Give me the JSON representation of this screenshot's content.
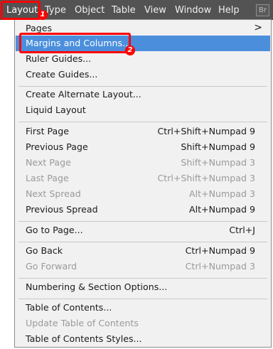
{
  "menubar": {
    "items": [
      {
        "label": "Layout"
      },
      {
        "label": "Type"
      },
      {
        "label": "Object"
      },
      {
        "label": "Table"
      },
      {
        "label": "View"
      },
      {
        "label": "Window"
      },
      {
        "label": "Help"
      }
    ],
    "badge": "Br"
  },
  "annotations": {
    "step1": "1",
    "step2": "2",
    "color": "#ff0000"
  },
  "menu": {
    "items": [
      {
        "label": "Pages",
        "shortcut": "",
        "submenu": true
      },
      {
        "label": "Margins and Columns...",
        "shortcut": "",
        "highlighted": true
      },
      {
        "label": "Ruler Guides...",
        "shortcut": ""
      },
      {
        "label": "Create Guides...",
        "shortcut": ""
      },
      {
        "label": "Create Alternate Layout...",
        "shortcut": ""
      },
      {
        "label": "Liquid Layout",
        "shortcut": ""
      },
      {
        "label": "First Page",
        "shortcut": "Ctrl+Shift+Numpad 9"
      },
      {
        "label": "Previous Page",
        "shortcut": "Shift+Numpad 9"
      },
      {
        "label": "Next Page",
        "shortcut": "Shift+Numpad 3",
        "disabled": true
      },
      {
        "label": "Last Page",
        "shortcut": "Ctrl+Shift+Numpad 3",
        "disabled": true
      },
      {
        "label": "Next Spread",
        "shortcut": "Alt+Numpad 3",
        "disabled": true
      },
      {
        "label": "Previous Spread",
        "shortcut": "Alt+Numpad 9"
      },
      {
        "label": "Go to Page...",
        "shortcut": "Ctrl+J"
      },
      {
        "label": "Go Back",
        "shortcut": "Ctrl+Numpad 9"
      },
      {
        "label": "Go Forward",
        "shortcut": "Ctrl+Numpad 3",
        "disabled": true
      },
      {
        "label": "Numbering & Section Options...",
        "shortcut": ""
      },
      {
        "label": "Table of Contents...",
        "shortcut": ""
      },
      {
        "label": "Update Table of Contents",
        "shortcut": "",
        "disabled": true
      },
      {
        "label": "Table of Contents Styles...",
        "shortcut": ""
      }
    ],
    "submenu_arrow": ">",
    "highlight_color": "#4b8fdc"
  }
}
